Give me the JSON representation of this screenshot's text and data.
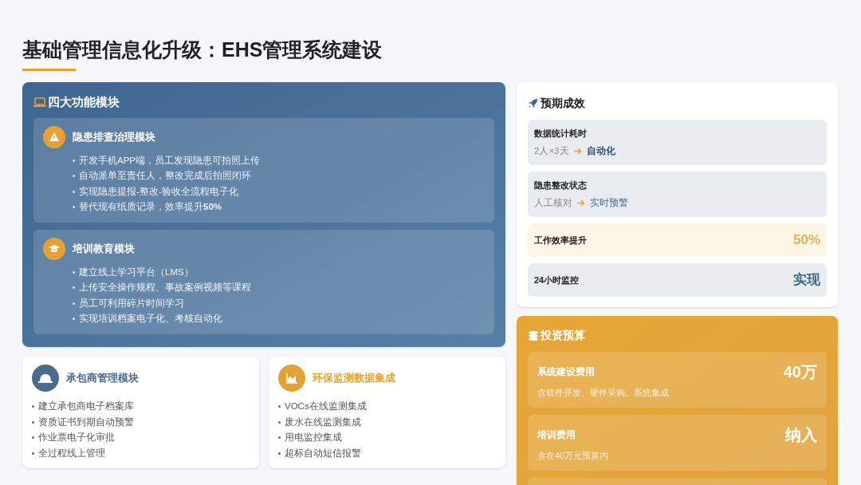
{
  "title": "基础管理信息化升级：EHS管理系统建设",
  "modules_panel": {
    "title": "四大功能模块",
    "modules": [
      {
        "title": "隐患排查治理模块",
        "points": [
          "开发手机APP端，员工发现隐患可拍照上传",
          "自动派单至责任人，整改完成后拍照闭环",
          "实现隐患提报-整改-验收全流程电子化",
          "替代现有纸质记录，效率提升**50%**"
        ]
      },
      {
        "title": "培训教育模块",
        "points": [
          "建立线上学习平台（LMS）",
          "上传安全操作规程、事故案例视频等课程",
          "员工可利用碎片时间学习",
          "实现培训档案电子化、考核自动化"
        ]
      }
    ]
  },
  "side_modules": [
    {
      "title": "承包商管理模块",
      "color": "#4b6b8e",
      "points": [
        "建立承包商电子档案库",
        "资质证书到期自动预警",
        "作业票电子化审批",
        "全过程线上管理"
      ]
    },
    {
      "title": "环保监测数据集成",
      "color": "#e3a233",
      "points": [
        "VOCs在线监测集成",
        "废水在线监测集成",
        "用电监控集成",
        "超标自动短信报警"
      ]
    }
  ],
  "results": {
    "title": "预期成效",
    "items": [
      {
        "kind": "change",
        "label": "数据统计耗时",
        "from": "2人×3天",
        "to": "自动化",
        "to_bold": true
      },
      {
        "kind": "change",
        "label": "隐患整改状态",
        "from": "人工核对",
        "to": "实时预警",
        "to_bold": false
      },
      {
        "kind": "metric",
        "label": "工作效率提升",
        "value": "50%",
        "highlight": true
      },
      {
        "kind": "metric",
        "label": "24小时监控",
        "value": "实现",
        "highlight": false
      }
    ]
  },
  "budget": {
    "title": "投资预算",
    "items": [
      {
        "label": "系统建设费用",
        "value": "40万",
        "note": "含软件开发、硬件采购、系统集成"
      },
      {
        "label": "培训费用",
        "value": "纳入",
        "note": "含在40万元预算内"
      }
    ]
  }
}
